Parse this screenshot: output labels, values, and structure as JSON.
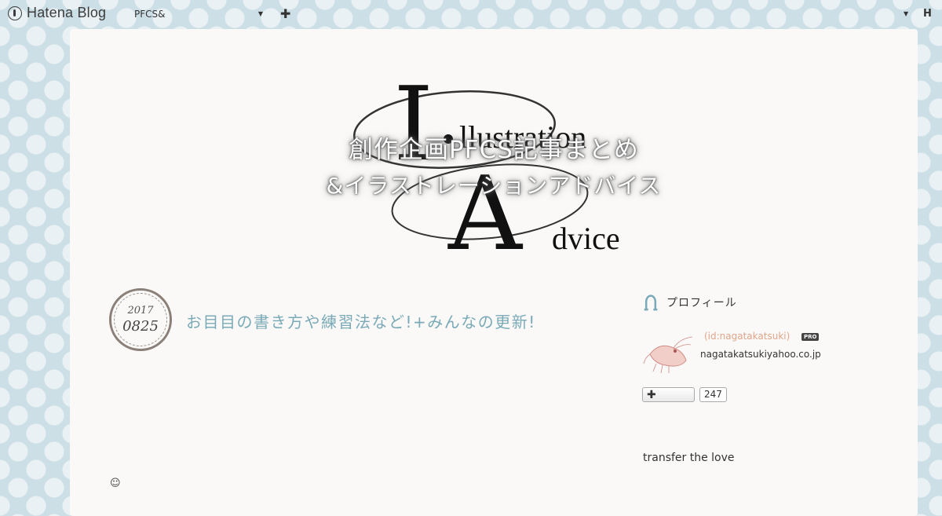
{
  "topbar": {
    "brand": "Hatena Blog",
    "blog_name": "PFCS&",
    "add_icon": "plus-icon",
    "right_icon": "hatena-icon",
    "right_label": "H"
  },
  "header": {
    "logo_line1": "llustration",
    "logo_line2": "dvice",
    "logo_letters": [
      "I",
      "A"
    ],
    "overlay_line1": "創作企画PFCS記事まとめ",
    "overlay_line2": "&イラストレーションアドバイス"
  },
  "entry": {
    "date_year": "2017",
    "date_md": "0825",
    "title": "お目目の書き方や練習法など!+みんなの更新!",
    "footer_icon": "face-icon"
  },
  "sidebar": {
    "section_title": "プロフィール",
    "section_icon": "horseshoe-icon",
    "profile_id": "(id:nagatakatsuki)",
    "pro_badge": "PRO",
    "profile_text": "nagatakatsukiyahoo.co.jp",
    "subscribe_icon": "plus-icon",
    "subscriber_count": "247",
    "transfer_text": "transfer the love"
  },
  "colors": {
    "background": "#cddfe6",
    "panel": "#faf9f7",
    "title_accent": "#7aaab8",
    "id_accent": "#e0a58a"
  }
}
